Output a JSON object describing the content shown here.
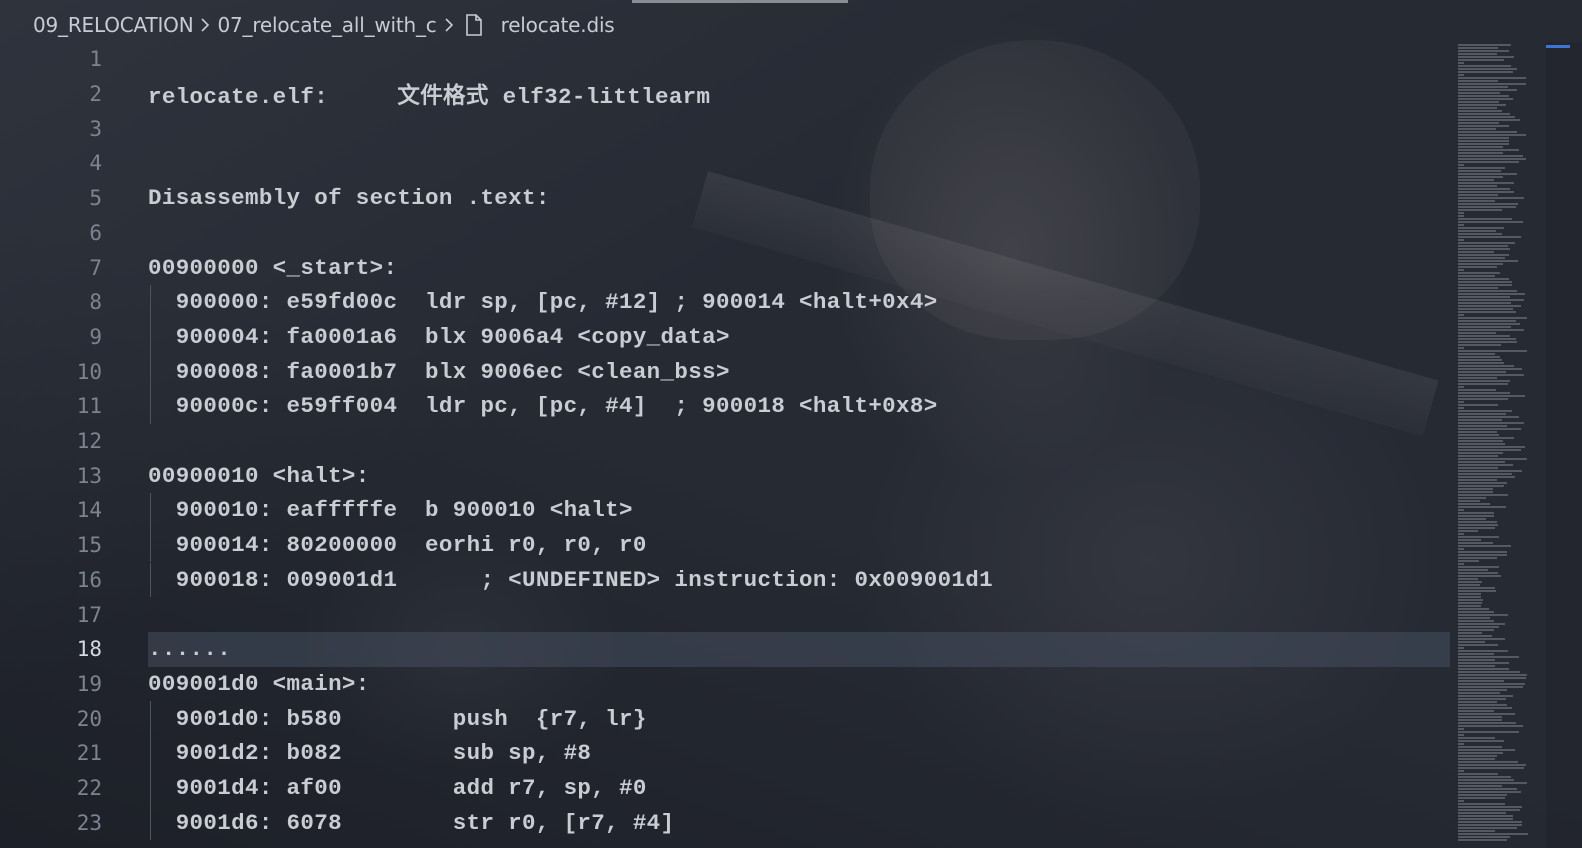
{
  "breadcrumb": {
    "items": [
      "09_RELOCATION",
      "07_relocate_all_with_c"
    ],
    "file": "relocate.dis",
    "file_icon": "file-icon",
    "separator_icon": "chevron-right-icon"
  },
  "editor": {
    "current_line": 18,
    "lines": [
      {
        "n": "1",
        "text": "",
        "indent": false
      },
      {
        "n": "2",
        "text": "relocate.elf:     文件格式 elf32-littlearm",
        "indent": false
      },
      {
        "n": "3",
        "text": "",
        "indent": false
      },
      {
        "n": "4",
        "text": "",
        "indent": false
      },
      {
        "n": "5",
        "text": "Disassembly of section .text:",
        "indent": false
      },
      {
        "n": "6",
        "text": "",
        "indent": false
      },
      {
        "n": "7",
        "text": "00900000 <_start>:",
        "indent": false
      },
      {
        "n": "8",
        "text": "  900000: e59fd00c  ldr sp, [pc, #12] ; 900014 <halt+0x4>",
        "indent": true
      },
      {
        "n": "9",
        "text": "  900004: fa0001a6  blx 9006a4 <copy_data>",
        "indent": true
      },
      {
        "n": "10",
        "text": "  900008: fa0001b7  blx 9006ec <clean_bss>",
        "indent": true
      },
      {
        "n": "11",
        "text": "  90000c: e59ff004  ldr pc, [pc, #4]  ; 900018 <halt+0x8>",
        "indent": true
      },
      {
        "n": "12",
        "text": "",
        "indent": false
      },
      {
        "n": "13",
        "text": "00900010 <halt>:",
        "indent": false
      },
      {
        "n": "14",
        "text": "  900010: eafffffe  b 900010 <halt>",
        "indent": true
      },
      {
        "n": "15",
        "text": "  900014: 80200000  eorhi r0, r0, r0",
        "indent": true
      },
      {
        "n": "16",
        "text": "  900018: 009001d1      ; <UNDEFINED> instruction: 0x009001d1",
        "indent": true
      },
      {
        "n": "17",
        "text": "",
        "indent": false
      },
      {
        "n": "18",
        "text": "......",
        "indent": false
      },
      {
        "n": "19",
        "text": "009001d0 <main>:",
        "indent": false
      },
      {
        "n": "20",
        "text": "  9001d0: b580        push  {r7, lr}",
        "indent": true
      },
      {
        "n": "21",
        "text": "  9001d2: b082        sub sp, #8",
        "indent": true
      },
      {
        "n": "22",
        "text": "  9001d4: af00        add r7, sp, #0",
        "indent": true
      },
      {
        "n": "23",
        "text": "  9001d6: 6078        str r0, [r7, #4]",
        "indent": true
      }
    ]
  },
  "colors": {
    "background": "#262a33",
    "text": "#c9ccd2",
    "line_number": "#7d8390",
    "current_line_bg": "#464e5f",
    "scroll_accent": "#3e74d6"
  }
}
